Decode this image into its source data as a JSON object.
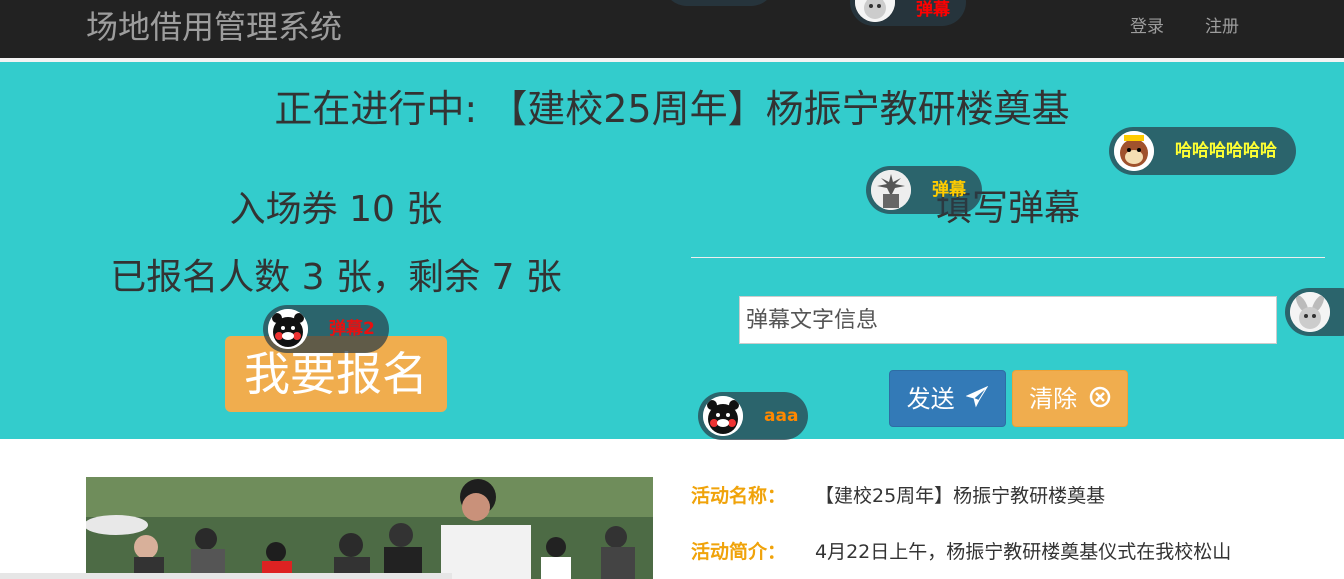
{
  "nav": {
    "brand": "场地借用管理系统",
    "login": "登录",
    "register": "注册"
  },
  "hero": {
    "title": "正在进行中: 【建校25周年】杨振宁教研楼奠基",
    "ticket_total": "入场券 10 张",
    "ticket_status": "已报名人数 3 张，剩余 7 张",
    "signup_button": "我要报名"
  },
  "danmu_form": {
    "heading": "填写弹幕",
    "placeholder": "弹幕文字信息",
    "send_label": "发送",
    "clear_label": "清除"
  },
  "danmu_bullets": [
    {
      "avatar": "rabbit-avatar",
      "text": "弹幕",
      "color": "#ff0000"
    },
    {
      "avatar": "monkey-avatar",
      "text": "哈哈哈哈哈哈",
      "color": "#ffff33"
    },
    {
      "avatar": "statue-avatar",
      "text": "弹幕",
      "color": "#ffcc00"
    },
    {
      "avatar": "kumamon-avatar",
      "text": "弹幕2",
      "color": "#e81010"
    },
    {
      "avatar": "kumamon-avatar",
      "text": "aaa",
      "color": "#ff8800"
    },
    {
      "avatar": "rabbit-avatar",
      "text": "",
      "color": "#ffffff"
    }
  ],
  "activity": {
    "name_label": "活动名称：",
    "name_value": "【建校25周年】杨振宁教研楼奠基",
    "intro_label": "活动简介：",
    "intro_value": "4月22日上午，杨振宁教研楼奠基仪式在我校松山"
  },
  "colors": {
    "hero_bg": "#33cccc",
    "navbar_bg": "#222222",
    "warning": "#f0ad4e",
    "primary": "#337ab7",
    "label_orange": "#f0a30a"
  }
}
